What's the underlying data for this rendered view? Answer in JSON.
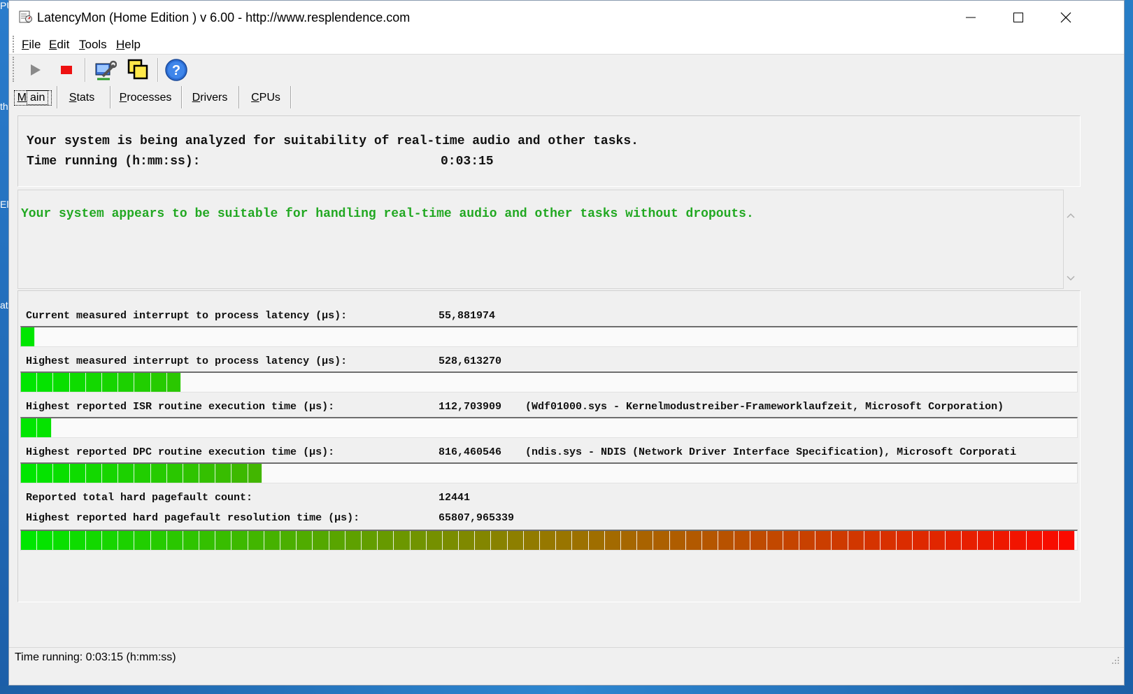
{
  "window": {
    "title": "LatencyMon  (Home Edition )  v 6.00 - http://www.resplendence.com"
  },
  "desktop_fragments": [
    "PU",
    "th",
    "El",
    "at"
  ],
  "menu": [
    {
      "label": "File",
      "accel": "F",
      "rest": "ile"
    },
    {
      "label": "Edit",
      "accel": "E",
      "rest": "dit"
    },
    {
      "label": "Tools",
      "accel": "T",
      "rest": "ools"
    },
    {
      "label": "Help",
      "accel": "H",
      "rest": "elp"
    }
  ],
  "toolbar": {
    "icons": [
      "play-icon",
      "stop-icon",
      "wrench-icon",
      "windows-icon",
      "help-icon"
    ]
  },
  "tabs": [
    {
      "label": "Main",
      "accel": "M",
      "rest": "ain",
      "active": true
    },
    {
      "label": "Stats",
      "accel": "S",
      "rest": "tats"
    },
    {
      "label": "Processes",
      "accel": "P",
      "rest": "rocesses"
    },
    {
      "label": "Drivers",
      "accel": "D",
      "rest": "rivers"
    },
    {
      "label": "CPUs",
      "accel": "C",
      "rest": "PUs"
    }
  ],
  "status": {
    "analyzing": "Your system is being analyzed for suitability of real-time audio and other tasks.",
    "time_label": "Time running (h:mm:ss):",
    "time_value": "0:03:15"
  },
  "verdict": {
    "text": "Your system appears to be suitable for handling real-time audio and other tasks without dropouts.",
    "color": "#22a822"
  },
  "metrics": {
    "current_latency": {
      "label": "Current measured interrupt to process latency (µs):",
      "value": "55,881974",
      "bar_fraction": 0.0132
    },
    "highest_latency": {
      "label": "Highest measured interrupt to process latency (µs):",
      "value": "528,613270",
      "bar_fraction": 0.152
    },
    "isr": {
      "label": "Highest reported ISR routine execution time (µs):",
      "value": "112,703909",
      "detail": "(Wdf01000.sys - Kernelmodustreiber-Frameworklaufzeit, Microsoft Corporation)",
      "bar_fraction": 0.029
    },
    "dpc": {
      "label": "Highest reported DPC routine execution time (µs):",
      "value": "816,460546",
      "detail": "(ndis.sys - NDIS (Network Driver Interface Specification), Microsoft Corporati",
      "bar_fraction": 0.229
    },
    "pagefault_count": {
      "label": "Reported total hard pagefault count:",
      "value": "12441"
    },
    "pagefault_time": {
      "label": "Highest reported hard pagefault resolution time (µs):",
      "value": "65807,965339",
      "bar_fraction": 1.0
    }
  },
  "statusbar": {
    "text": "Time running: 0:03:15  (h:mm:ss)"
  }
}
